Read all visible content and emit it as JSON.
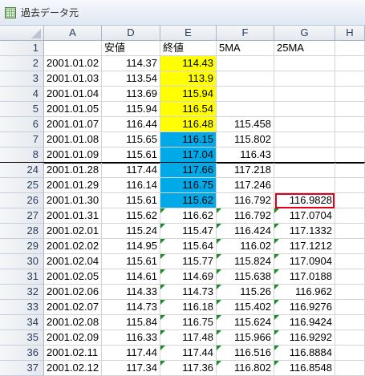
{
  "window": {
    "title": "過去データ元",
    "icon": "excel-sheet-icon"
  },
  "columns": [
    "A",
    "D",
    "E",
    "F",
    "G",
    "H"
  ],
  "header_row": {
    "num": "1",
    "cells": [
      "",
      "安値",
      "終値",
      "5MA",
      "25MA",
      ""
    ]
  },
  "rows": [
    {
      "num": "2",
      "date": "2001.01.02",
      "low": "114.37",
      "close": "114.43",
      "ma5": "",
      "ma25": ""
    },
    {
      "num": "3",
      "date": "2001.01.03",
      "low": "113.54",
      "close": "113.9",
      "ma5": "",
      "ma25": ""
    },
    {
      "num": "4",
      "date": "2001.01.04",
      "low": "113.69",
      "close": "115.94",
      "ma5": "",
      "ma25": ""
    },
    {
      "num": "5",
      "date": "2001.01.05",
      "low": "115.94",
      "close": "116.54",
      "ma5": "",
      "ma25": ""
    },
    {
      "num": "6",
      "date": "2001.01.07",
      "low": "116.44",
      "close": "116.48",
      "ma5": "115.458",
      "ma25": ""
    },
    {
      "num": "7",
      "date": "2001.01.08",
      "low": "115.65",
      "close": "116.15",
      "ma5": "115.802",
      "ma25": ""
    },
    {
      "num": "8",
      "date": "2001.01.09",
      "low": "115.61",
      "close": "117.04",
      "ma5": "116.43",
      "ma25": ""
    },
    {
      "num": "24",
      "date": "2001.01.28",
      "low": "117.44",
      "close": "117.66",
      "ma5": "117.218",
      "ma25": ""
    },
    {
      "num": "25",
      "date": "2001.01.29",
      "low": "116.14",
      "close": "116.75",
      "ma5": "117.246",
      "ma25": ""
    },
    {
      "num": "26",
      "date": "2001.01.30",
      "low": "115.61",
      "close": "115.62",
      "ma5": "116.792",
      "ma25": "116.9828"
    },
    {
      "num": "27",
      "date": "2001.01.31",
      "low": "115.62",
      "close": "116.62",
      "ma5": "116.792",
      "ma25": "117.0704"
    },
    {
      "num": "28",
      "date": "2001.02.01",
      "low": "115.24",
      "close": "115.47",
      "ma5": "116.424",
      "ma25": "117.1332"
    },
    {
      "num": "29",
      "date": "2001.02.02",
      "low": "114.95",
      "close": "115.64",
      "ma5": "116.02",
      "ma25": "117.1212"
    },
    {
      "num": "30",
      "date": "2001.02.04",
      "low": "115.61",
      "close": "115.77",
      "ma5": "115.824",
      "ma25": "117.0904"
    },
    {
      "num": "31",
      "date": "2001.02.05",
      "low": "114.61",
      "close": "114.69",
      "ma5": "115.638",
      "ma25": "117.0188"
    },
    {
      "num": "32",
      "date": "2001.02.06",
      "low": "114.33",
      "close": "114.73",
      "ma5": "115.26",
      "ma25": "116.962"
    },
    {
      "num": "33",
      "date": "2001.02.07",
      "low": "114.73",
      "close": "116.18",
      "ma5": "115.402",
      "ma25": "116.9276"
    },
    {
      "num": "34",
      "date": "2001.02.08",
      "low": "115.84",
      "close": "116.75",
      "ma5": "115.624",
      "ma25": "116.9424"
    },
    {
      "num": "35",
      "date": "2001.02.09",
      "low": "116.33",
      "close": "117.48",
      "ma5": "115.966",
      "ma25": "116.9292"
    },
    {
      "num": "36",
      "date": "2001.02.11",
      "low": "117.44",
      "close": "117.44",
      "ma5": "116.516",
      "ma25": "116.8884"
    },
    {
      "num": "37",
      "date": "2001.02.12",
      "low": "117.34",
      "close": "117.36",
      "ma5": "116.802",
      "ma25": "116.8548"
    }
  ],
  "highlight_colors": {
    "yellow": "#ffff00",
    "blue": "#00a9e8",
    "red_box": "#e0001b"
  }
}
